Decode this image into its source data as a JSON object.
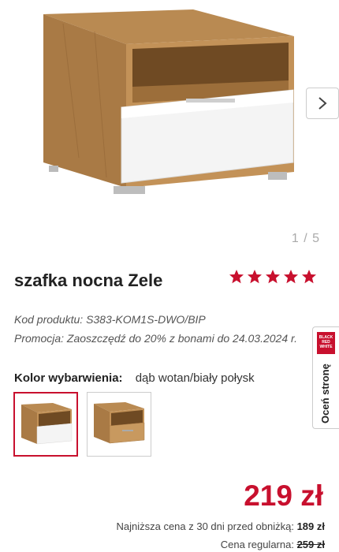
{
  "gallery": {
    "image_alt": "szafka nocna Zele",
    "pager_current": "1",
    "pager_separator": " / ",
    "pager_total": "5",
    "next_icon": "chevron-right-icon"
  },
  "product": {
    "title": "szafka nocna Zele",
    "rating_stars": 5,
    "star_color": "#c8102e",
    "code_label": "Kod produktu:",
    "code_value": "S383-KOM1S-DWO/BIP",
    "promo_label": "Promocja:",
    "promo_text": "Zaoszczędź do 20% z bonami do 24.03.2024 r."
  },
  "rate_tab": {
    "label": "Oceń stronę",
    "logo_lines": [
      "BLACK",
      "RED",
      "WHITE"
    ]
  },
  "color": {
    "label": "Kolor wybarwienia:",
    "value": "dąb wotan/biały połysk",
    "options": [
      {
        "name": "dąb wotan/biały połysk",
        "selected": true
      },
      {
        "name": "dąb wotan",
        "selected": false
      }
    ]
  },
  "pricing": {
    "price": "219 zł",
    "lowest_label": "Najniższa cena z 30 dni przed obniżką:",
    "lowest_value": "189 zł",
    "regular_label": "Cena regularna:",
    "regular_value": "259 zł",
    "accent_color": "#c8102e"
  }
}
